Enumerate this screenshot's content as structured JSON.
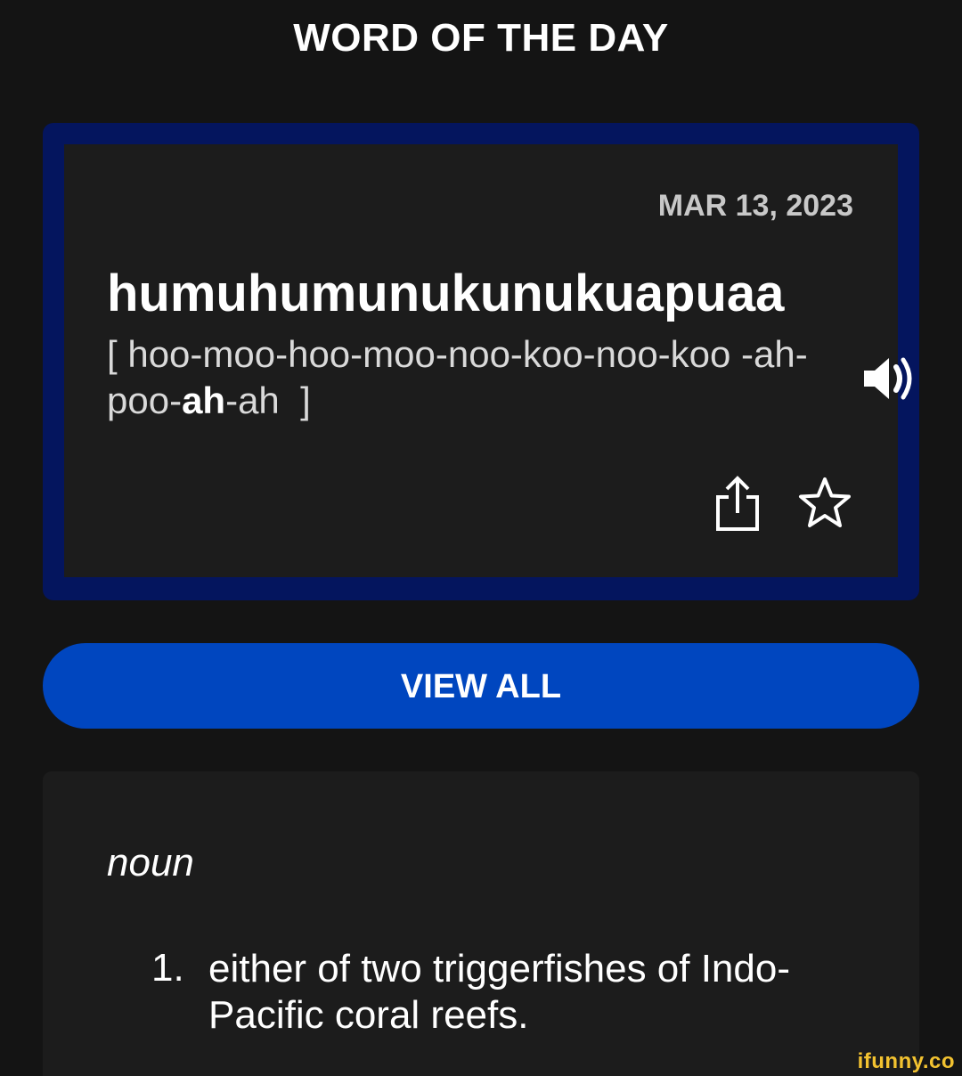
{
  "header": {
    "title": "WORD OF THE DAY"
  },
  "word_card": {
    "date": "MAR 13, 2023",
    "word": "humuhumunukunukuapuaa",
    "pronunciation": {
      "open_bracket": "[",
      "before_stress": "hoo-moo-hoo-moo-noo-koo-noo-koo -ah-poo-",
      "stressed": "ah",
      "after_stress": "-ah",
      "close_bracket": "]"
    },
    "icons": {
      "audio": "speaker-icon",
      "share": "share-icon",
      "favorite": "star-icon"
    }
  },
  "actions": {
    "view_all_label": "VIEW ALL"
  },
  "definition": {
    "part_of_speech": "noun",
    "items": [
      {
        "number": "1.",
        "text": "either of two triggerfishes of Indo-Pacific coral reefs."
      }
    ]
  },
  "watermark": "ifunny.co",
  "colors": {
    "background": "#141414",
    "card_border": "#04155e",
    "card_fill": "#1c1c1c",
    "button": "#0046bf",
    "watermark": "#f2c230"
  }
}
